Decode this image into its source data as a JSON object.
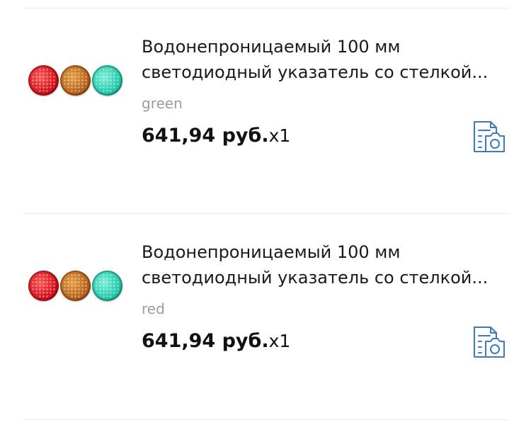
{
  "items": [
    {
      "title_line1": "Водонепроницаемый 100 мм",
      "title_line2": "светодиодный указатель со стелкой...",
      "variant": "green",
      "price": "641,94 руб.",
      "qty": "x1",
      "thumb_icon": "traffic-light-leds-thumbnail",
      "action_icon": "document-camera-icon"
    },
    {
      "title_line1": "Водонепроницаемый 100 мм",
      "title_line2": "светодиодный указатель со стелкой...",
      "variant": "red",
      "price": "641,94 руб.",
      "qty": "x1",
      "thumb_icon": "traffic-light-leds-thumbnail",
      "action_icon": "document-camera-icon"
    }
  ],
  "colors": {
    "accent": "#3b7bbf",
    "divider": "#ececec",
    "variant_text": "#9b9b9b"
  }
}
